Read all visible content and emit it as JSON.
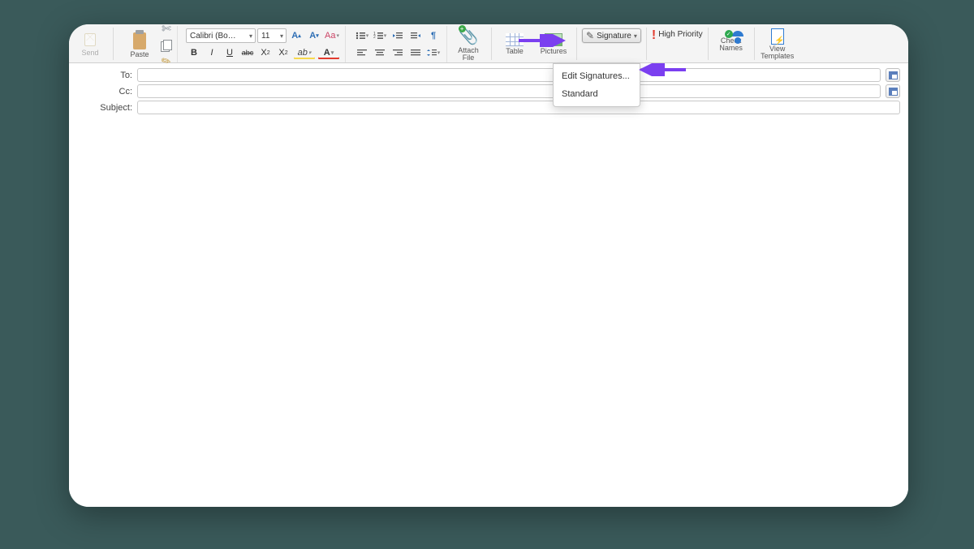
{
  "ribbon": {
    "send": "Send",
    "paste": "Paste",
    "font_name": "Calibri (Bo…",
    "font_size": "11",
    "attach": "Attach\nFile",
    "table": "Table",
    "pictures": "Pictures",
    "signature": "Signature",
    "high_priority": "High Priority",
    "check_names": "Check\nNames",
    "view_templates": "View\nTemplates"
  },
  "signature_menu": {
    "edit": "Edit Signatures...",
    "standard": "Standard"
  },
  "fields": {
    "to": "To:",
    "cc": "Cc:",
    "subject": "Subject:",
    "to_value": "",
    "cc_value": "",
    "subject_value": ""
  },
  "fmt": {
    "bold": "B",
    "italic": "I",
    "underline": "U",
    "strike": "abc",
    "sub": "X",
    "sup": "X",
    "grow": "A",
    "shrink": "A",
    "clear": "Aa",
    "para": "¶"
  }
}
